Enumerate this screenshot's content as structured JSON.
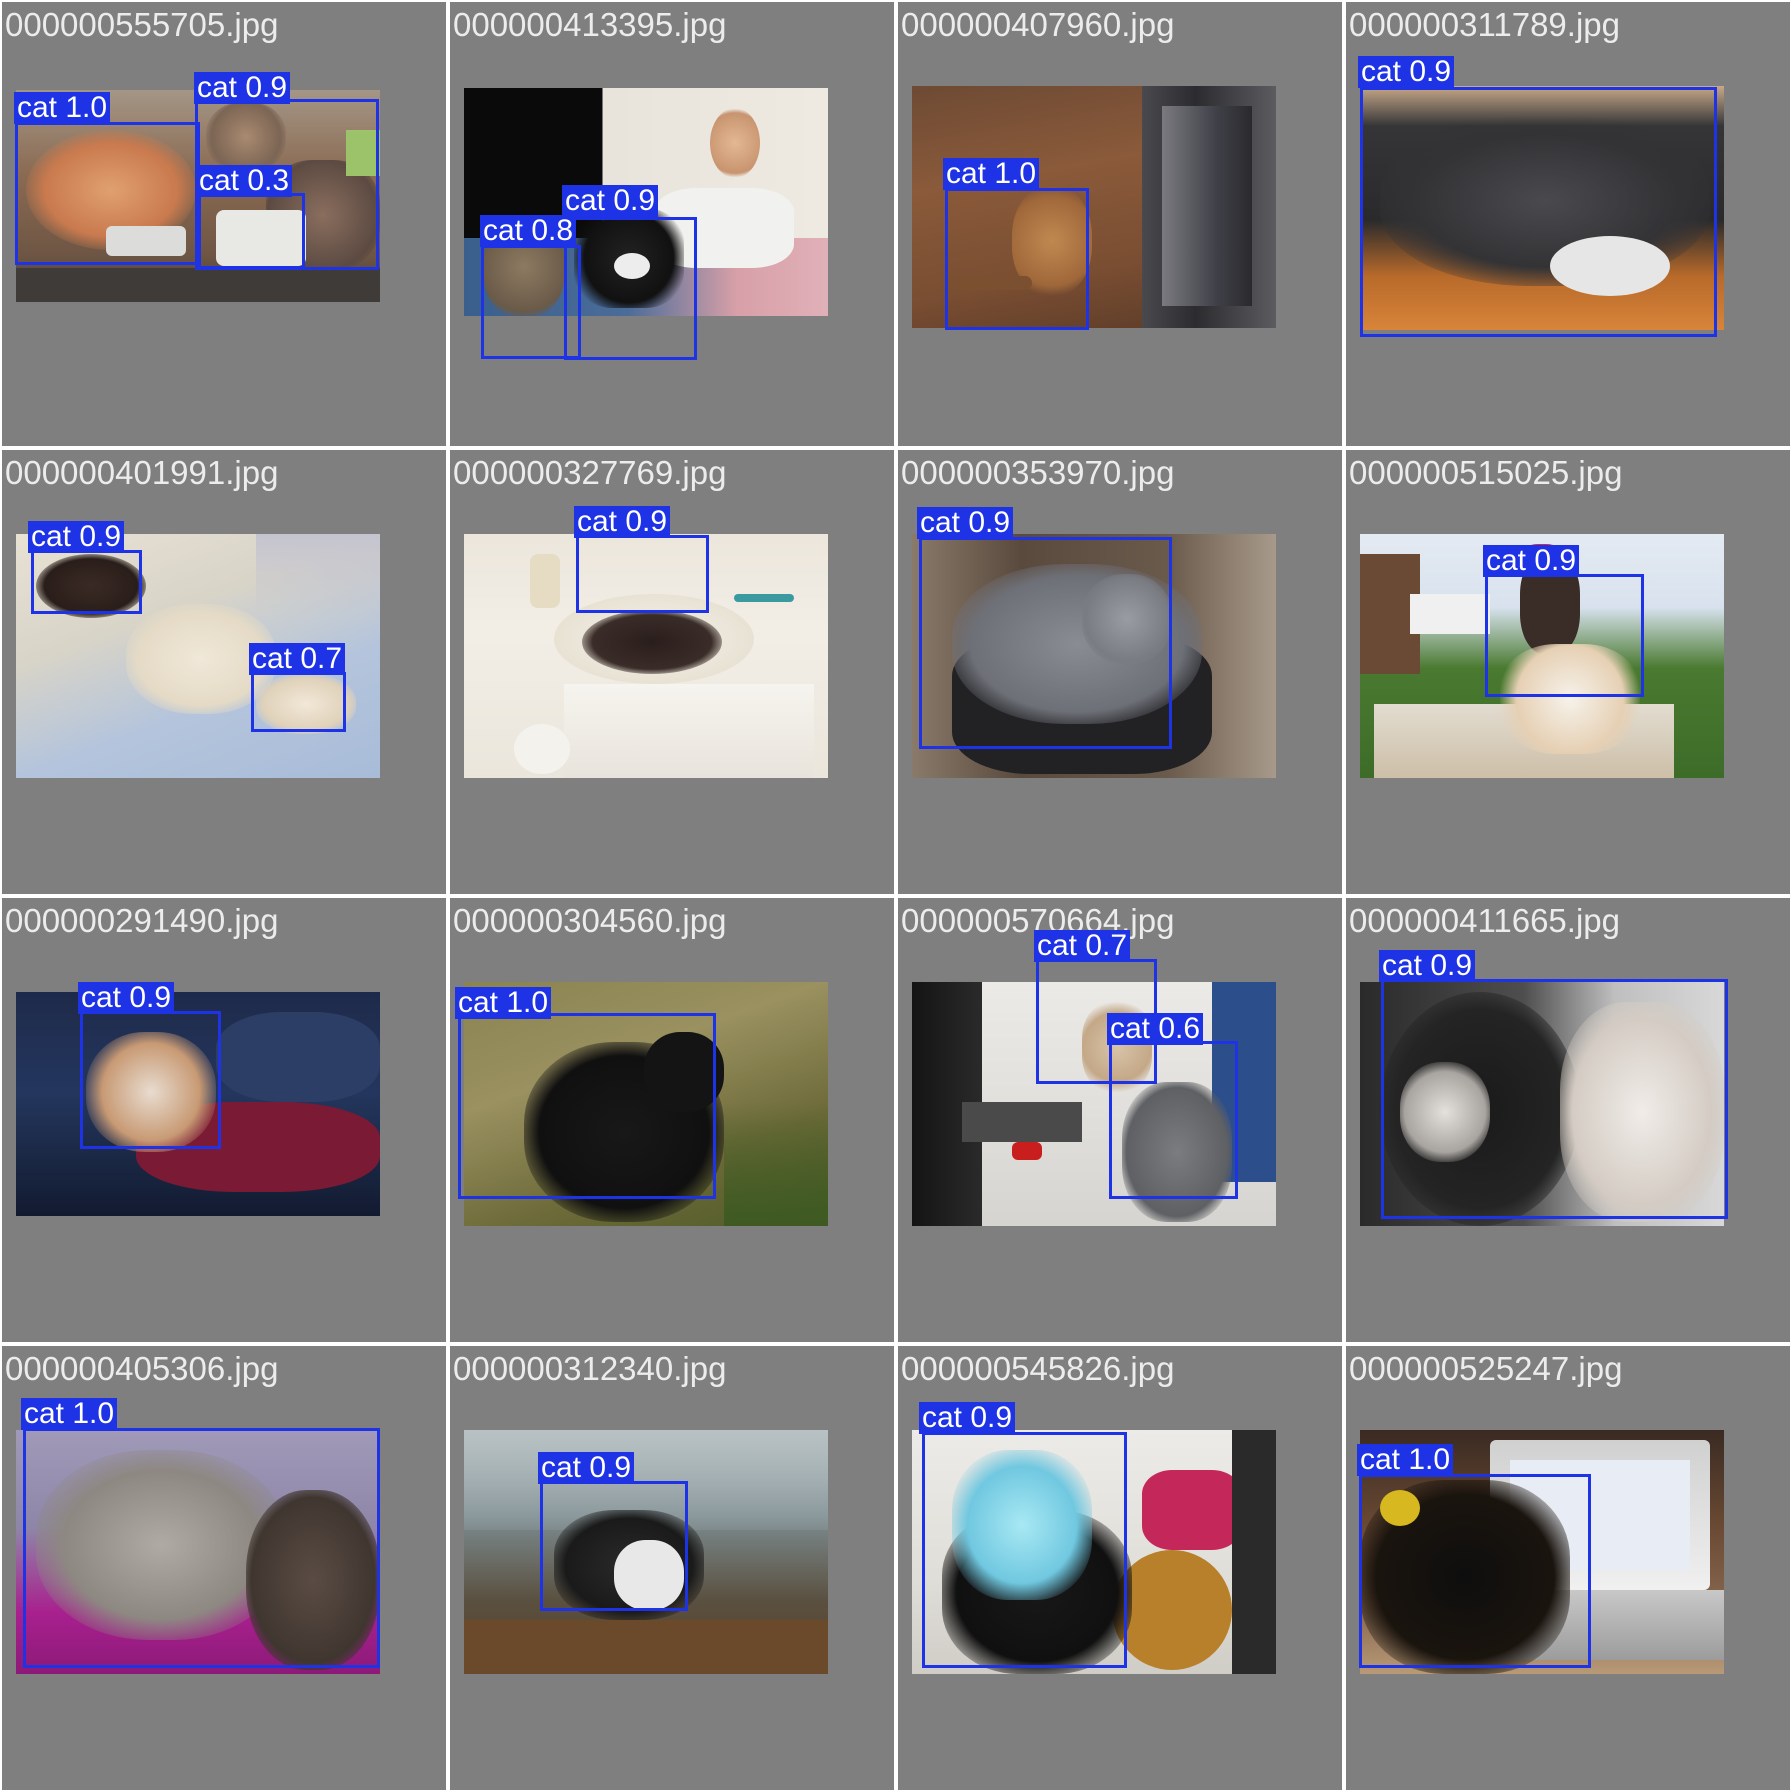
{
  "box_color": "#1e32e6",
  "tile_color": "#7f7f7f",
  "tiles": [
    {
      "filename": "000000555705.jpg",
      "detections": [
        {
          "label": "cat 1.0"
        },
        {
          "label": "cat 0.9"
        },
        {
          "label": "cat 0.3"
        }
      ]
    },
    {
      "filename": "000000413395.jpg",
      "detections": [
        {
          "label": "cat 0.9"
        },
        {
          "label": "cat 0.8"
        }
      ]
    },
    {
      "filename": "000000407960.jpg",
      "detections": [
        {
          "label": "cat 1.0"
        }
      ]
    },
    {
      "filename": "000000311789.jpg",
      "detections": [
        {
          "label": "cat 0.9"
        }
      ]
    },
    {
      "filename": "000000401991.jpg",
      "detections": [
        {
          "label": "cat 0.9"
        },
        {
          "label": "cat 0.7"
        }
      ]
    },
    {
      "filename": "000000327769.jpg",
      "detections": [
        {
          "label": "cat 0.9"
        }
      ]
    },
    {
      "filename": "000000353970.jpg",
      "detections": [
        {
          "label": "cat 0.9"
        }
      ]
    },
    {
      "filename": "000000515025.jpg",
      "detections": [
        {
          "label": "cat 0.9"
        }
      ]
    },
    {
      "filename": "000000291490.jpg",
      "detections": [
        {
          "label": "cat 0.9"
        }
      ]
    },
    {
      "filename": "000000304560.jpg",
      "detections": [
        {
          "label": "cat 1.0"
        }
      ]
    },
    {
      "filename": "000000570664.jpg",
      "detections": [
        {
          "label": "cat 0.7"
        },
        {
          "label": "cat 0.6"
        }
      ]
    },
    {
      "filename": "000000411665.jpg",
      "detections": [
        {
          "label": "cat 0.9"
        }
      ]
    },
    {
      "filename": "000000405306.jpg",
      "detections": [
        {
          "label": "cat 1.0"
        }
      ]
    },
    {
      "filename": "000000312340.jpg",
      "detections": [
        {
          "label": "cat 0.9"
        }
      ]
    },
    {
      "filename": "000000545826.jpg",
      "detections": [
        {
          "label": "cat 0.9"
        }
      ]
    },
    {
      "filename": "000000525247.jpg",
      "detections": [
        {
          "label": "cat 1.0"
        }
      ]
    }
  ]
}
